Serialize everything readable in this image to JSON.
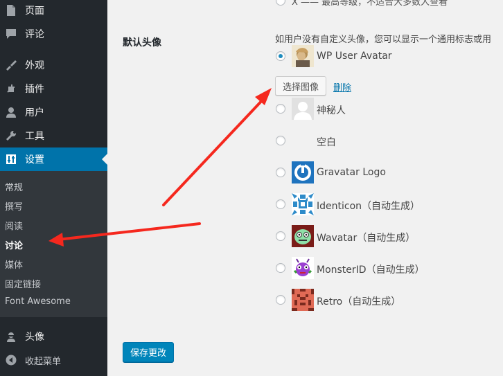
{
  "sidebar": {
    "items": [
      {
        "label": "页面",
        "icon": "page-icon"
      },
      {
        "label": "评论",
        "icon": "comment-icon"
      },
      {
        "label": "外观",
        "icon": "paintbrush-icon"
      },
      {
        "label": "插件",
        "icon": "plugin-icon"
      },
      {
        "label": "用户",
        "icon": "user-icon"
      },
      {
        "label": "工具",
        "icon": "wrench-icon"
      },
      {
        "label": "设置",
        "icon": "settings-icon"
      }
    ],
    "submenu": [
      "常规",
      "撰写",
      "阅读",
      "讨论",
      "媒体",
      "固定链接",
      "Font Awesome"
    ],
    "current_submenu": "讨论",
    "avatar_menu": {
      "label": "头像",
      "icon": "avatar-icon"
    },
    "collapse": {
      "label": "收起菜单",
      "icon": "collapse-icon"
    },
    "colors": {
      "bg": "#23282d",
      "active": "#0073aa",
      "submenu_bg": "#32373c"
    }
  },
  "main": {
    "top_partial_text": "X —— 最高等级，不适合大多数人查看",
    "section_title": "默认头像",
    "description": "如用户没有自定义头像，您可以显示一个通用标志或用",
    "options": [
      {
        "label": "WP User Avatar",
        "checked": true,
        "avatar": "wp-user-avatar"
      },
      {
        "label": "神秘人",
        "checked": false,
        "avatar": "mystery-man"
      },
      {
        "label": "空白",
        "checked": false,
        "avatar": "blank"
      },
      {
        "label": "Gravatar Logo",
        "checked": false,
        "avatar": "gravatar-logo"
      },
      {
        "label": "Identicon（自动生成）",
        "checked": false,
        "avatar": "identicon"
      },
      {
        "label": "Wavatar（自动生成）",
        "checked": false,
        "avatar": "wavatar"
      },
      {
        "label": "MonsterID（自动生成）",
        "checked": false,
        "avatar": "monsterid"
      },
      {
        "label": "Retro（自动生成）",
        "checked": false,
        "avatar": "retro"
      }
    ],
    "choose_image_button": "选择图像",
    "remove_link": "删除",
    "save_button": "保存更改",
    "colors": {
      "primary": "#0085ba",
      "link": "#0073aa",
      "annotation_arrow": "#f5281e"
    }
  }
}
